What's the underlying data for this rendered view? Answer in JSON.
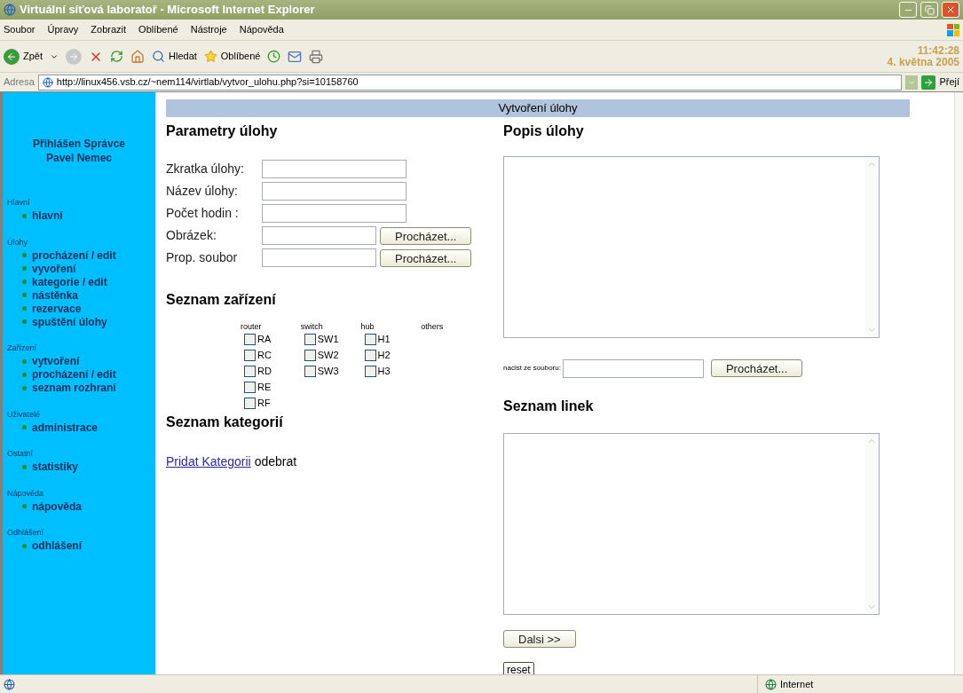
{
  "window": {
    "title": "Virtuální síťová laboratoř - Microsoft Internet Explorer"
  },
  "menu": [
    "Soubor",
    "Úpravy",
    "Zobrazit",
    "Oblíbené",
    "Nástroje",
    "Nápověda"
  ],
  "toolbar": {
    "back": "Zpět",
    "search": "Hledat",
    "favorites": "Oblíbené",
    "clock": "11:42:28",
    "date": "4. května 2005"
  },
  "address": {
    "label": "Adresa",
    "value": "http://linux456.vsb.cz/~nem114/virtlab/vytvor_ulohu.php?si=10158760",
    "go": "Přejí"
  },
  "sidebar": {
    "user_title": "Přihlášen Správce",
    "user_name": "Pavel Nemec",
    "sections": [
      {
        "title": "Hlavní",
        "items": [
          "hlavní"
        ]
      },
      {
        "title": "Úlohy",
        "items": [
          "procházení / edit",
          "vyvoření",
          "kategorie / edit",
          "nástěnka",
          "rezervace",
          "spuštění úlohy"
        ]
      },
      {
        "title": "Zařízení",
        "items": [
          "vytvoření",
          "procházení / edit",
          "seznam rozhraní"
        ]
      },
      {
        "title": "Uživatelé",
        "items": [
          "administrace"
        ]
      },
      {
        "title": "Ostatní",
        "items": [
          "statistiky"
        ]
      },
      {
        "title": "Nápověda",
        "items": [
          "nápověda"
        ]
      },
      {
        "title": "Odhlášení",
        "items": [
          "odhlášení"
        ]
      }
    ]
  },
  "page_header": "Vytvoření úlohy",
  "parameters": {
    "title": "Parametry úlohy",
    "fields": [
      {
        "label": "Zkratka úlohy:",
        "kind": "text"
      },
      {
        "label": "Název úlohy:",
        "kind": "text"
      },
      {
        "label": "Počet hodin :",
        "kind": "text"
      },
      {
        "label": "Obrázek:",
        "kind": "file",
        "button": "Procházet..."
      },
      {
        "label": "Prop. soubor",
        "kind": "file",
        "button": "Procházet..."
      }
    ]
  },
  "devices": {
    "title": "Seznam zařízení",
    "columns": [
      {
        "heading": "router",
        "items": [
          {
            "label": "RA",
            "checked": false
          },
          {
            "label": "RC",
            "checked": false
          },
          {
            "label": "RD",
            "checked": false
          },
          {
            "label": "RE",
            "checked": false
          },
          {
            "label": "RF",
            "checked": false
          }
        ]
      },
      {
        "heading": "switch",
        "items": [
          {
            "label": "SW1",
            "checked": false
          },
          {
            "label": "SW2",
            "checked": false
          },
          {
            "label": "SW3",
            "checked": false
          }
        ]
      },
      {
        "heading": "hub",
        "items": [
          {
            "label": "H1",
            "checked": false
          },
          {
            "label": "H2",
            "checked": false
          },
          {
            "label": "H3",
            "checked": false
          }
        ]
      },
      {
        "heading": "others"
      }
    ]
  },
  "categories": {
    "title": "Seznam kategorií",
    "add_link": "Pridat Kategorii",
    "remove": "odebrat"
  },
  "description": {
    "title": "Popis úlohy",
    "load_label": "nacist ze souboru:",
    "button": "Procházet..."
  },
  "links": {
    "title": "Seznam linek"
  },
  "buttons": {
    "next": "Dalsi >>",
    "reset": "reset"
  },
  "status_bar": {
    "zone": "Internet"
  }
}
